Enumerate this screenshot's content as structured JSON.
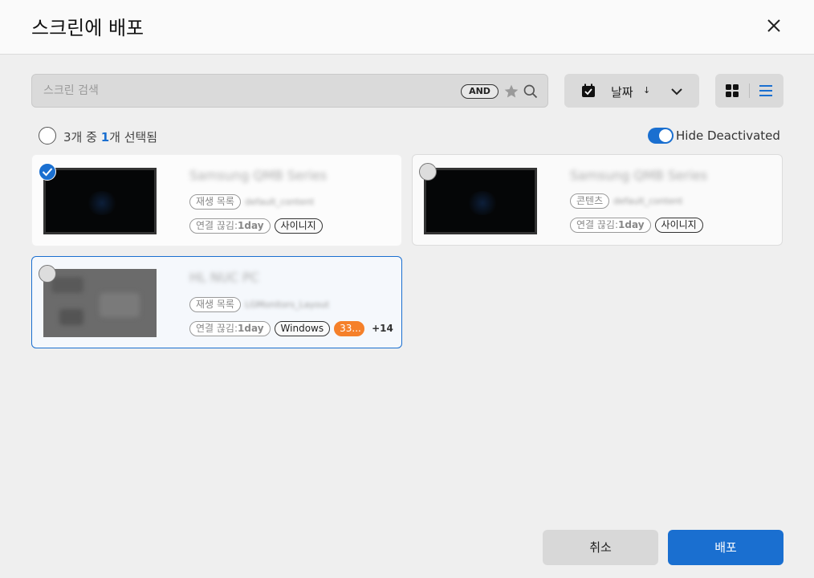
{
  "dialog": {
    "title": "스크린에 배포"
  },
  "search": {
    "placeholder": "스크린 검색",
    "and_label": "AND"
  },
  "sort": {
    "label": "날짜",
    "direction_glyph": "↓"
  },
  "selection": {
    "count_prefix": "3개 중 ",
    "selected": "1",
    "count_suffix": "개 선택됨"
  },
  "filter": {
    "hide_deactivated_label": "Hide Deactivated",
    "hide_deactivated_on": true
  },
  "cards": [
    {
      "name": "Samsung QMB Series",
      "selected": true,
      "content_type": "재생 목록",
      "content_value": "default_content",
      "connection_prefix": "연결 끊김:",
      "connection_value": "1day",
      "tags": [
        "사이니지"
      ]
    },
    {
      "name": "Samsung QMB Series",
      "selected": false,
      "content_type": "콘텐츠",
      "content_value": "default_content",
      "connection_prefix": "연결 끊김:",
      "connection_value": "1day",
      "tags": [
        "사이니지"
      ]
    },
    {
      "name": "HL NUC PC",
      "selected": false,
      "content_type": "재생 목록",
      "content_value": "LGMonitors_Layout",
      "connection_prefix": "연결 끊김:",
      "connection_value": "1day",
      "tags": [
        "Windows",
        "33..."
      ],
      "more": "+14"
    }
  ],
  "footer": {
    "cancel_label": "취소",
    "deploy_label": "배포"
  },
  "colors": {
    "accent": "#1a6fd0",
    "tag_orange": "#f5802a"
  }
}
